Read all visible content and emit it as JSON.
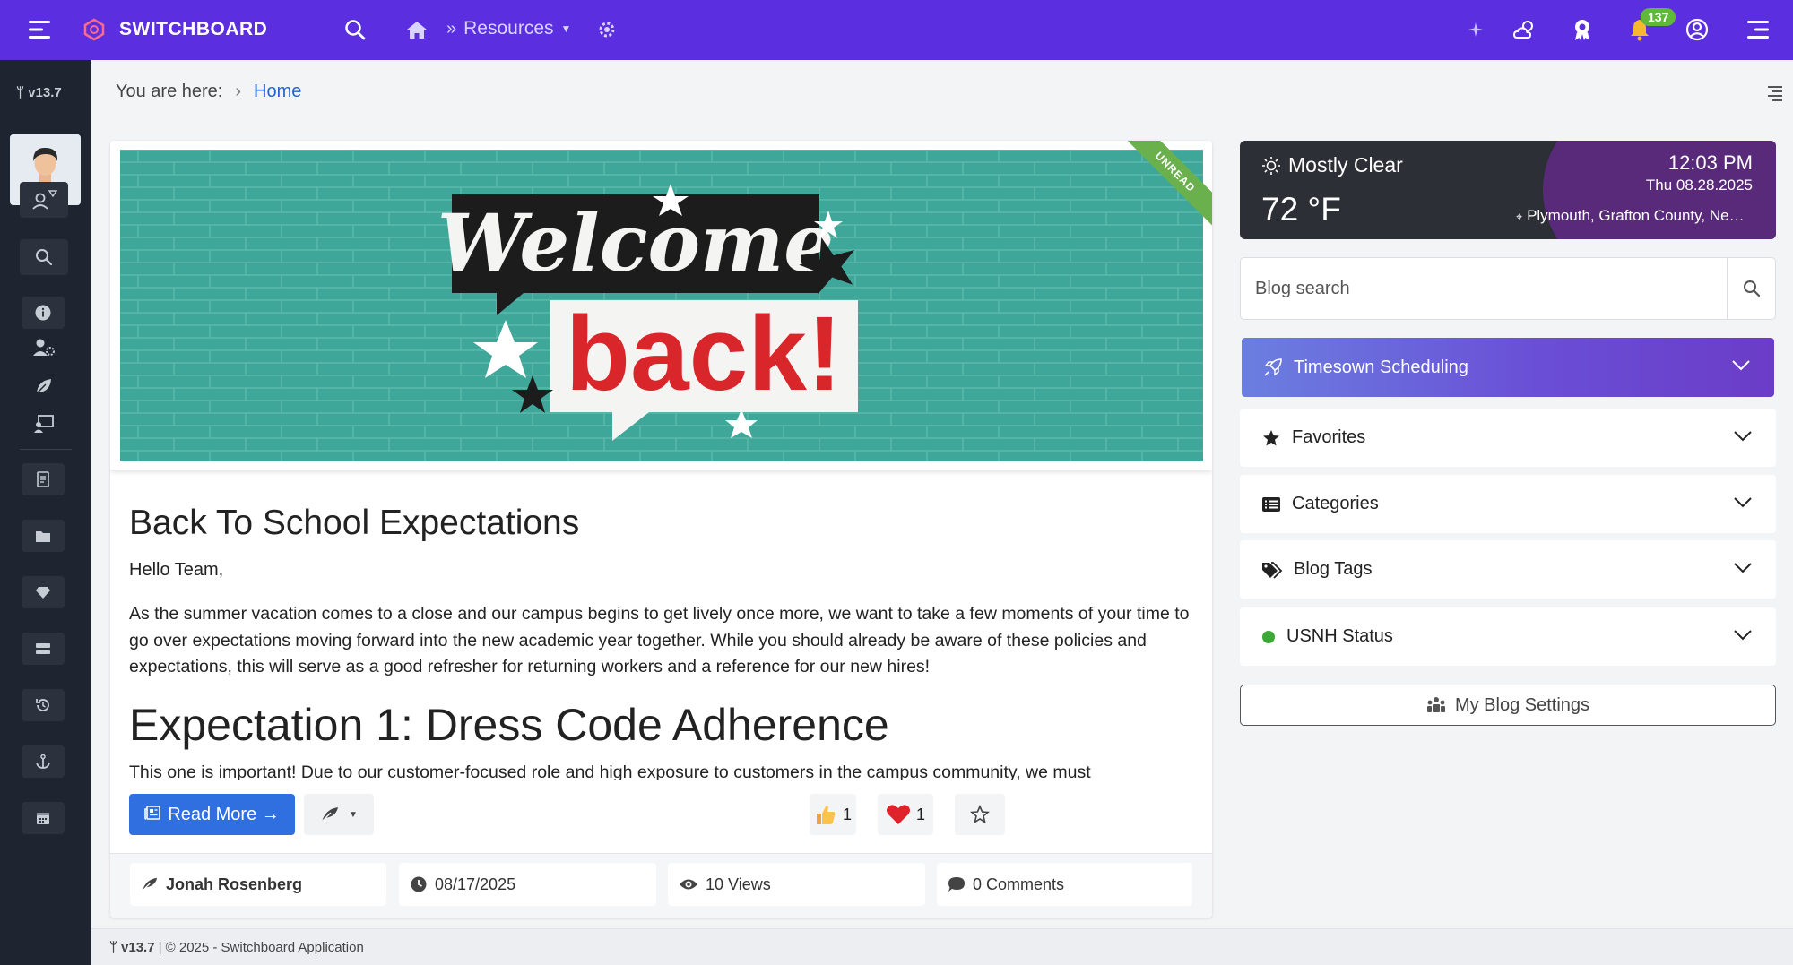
{
  "colors": {
    "topbar": "#5b2fe0",
    "sidebar": "#1f2530",
    "link": "#2563c9",
    "primary_button": "#2f6fe0",
    "ribbon": "#6ab04c",
    "status_dot": "#3aa935"
  },
  "topbar": {
    "brand": "SWITCHBOARD",
    "resources_label": "Resources",
    "notification_count": "137"
  },
  "sidebar": {
    "version": "v13.7"
  },
  "breadcrumb": {
    "prefix": "You are here:",
    "home": "Home"
  },
  "post": {
    "ribbon": "UNREAD",
    "hero_line1": "Welcome",
    "hero_line2": "back!",
    "title": "Back To School Expectations",
    "greeting": "Hello Team,",
    "body": "As the summer vacation comes to a close and our campus begins to get lively once more, we want to take a few moments of your time to go over expectations moving forward into the new academic year together. While you should already be aware of these policies and expectations, this will serve as a good refresher for returning workers and a reference for our new hires!",
    "heading": "Expectation 1: Dress Code Adherence",
    "cut_text": "This one is important! Due to our customer-focused role and high exposure to customers in the campus community, we must",
    "read_more": "Read More →",
    "likes": "1",
    "hearts": "1",
    "author": "Jonah Rosenberg",
    "date": "08/17/2025",
    "views": "10 Views",
    "comments": "0 Comments"
  },
  "weather": {
    "condition": "Mostly Clear",
    "temperature": "72 °F",
    "time": "12:03 PM",
    "date": "Thu 08.28.2025",
    "location": "Plymouth, Grafton County, New Hampshire"
  },
  "search": {
    "placeholder": "Blog search"
  },
  "panels": {
    "scheduling": "Timesown Scheduling",
    "favorites": "Favorites",
    "categories": "Categories",
    "tags": "Blog Tags",
    "status": "USNH Status",
    "settings": "My Blog Settings"
  },
  "footer": {
    "version": "v13.7",
    "text": "| © 2025 - Switchboard Application"
  }
}
